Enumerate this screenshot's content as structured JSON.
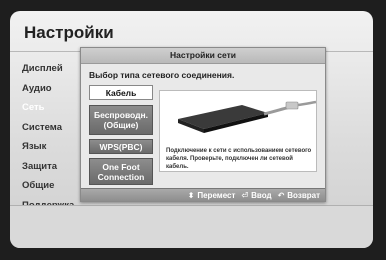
{
  "screen": {
    "title": "Настройки"
  },
  "menu": {
    "items": [
      {
        "label": "Дисплей"
      },
      {
        "label": "Аудио"
      },
      {
        "label": "Сеть"
      },
      {
        "label": "Система"
      },
      {
        "label": "Язык"
      },
      {
        "label": "Защита"
      },
      {
        "label": "Общие"
      },
      {
        "label": "Поддержка"
      }
    ],
    "active_index": 2
  },
  "dialog": {
    "title": "Настройки сети",
    "subtitle": "Выбор типа сетевого соединения.",
    "options": [
      {
        "label": "Кабель",
        "selected": true
      },
      {
        "label": "Беспроводн. (Общие)",
        "selected": false
      },
      {
        "label": "WPS(PBC)",
        "selected": false
      },
      {
        "label": "One Foot Connection",
        "selected": false
      }
    ],
    "description": "Подключение к сети с использованием сетевого кабеля. Проверьте, подключен ли сетевой кабель.",
    "footer": {
      "move": {
        "icon": "up-down-arrows-icon",
        "label": "Перемест"
      },
      "enter": {
        "icon": "enter-icon",
        "label": "Ввод"
      },
      "back": {
        "icon": "return-icon",
        "label": "Возврат"
      }
    }
  },
  "colors": {
    "active_menu": "#ffffff",
    "option_bg": "#7a7a7a",
    "selected_option_bg": "#ffffff"
  }
}
